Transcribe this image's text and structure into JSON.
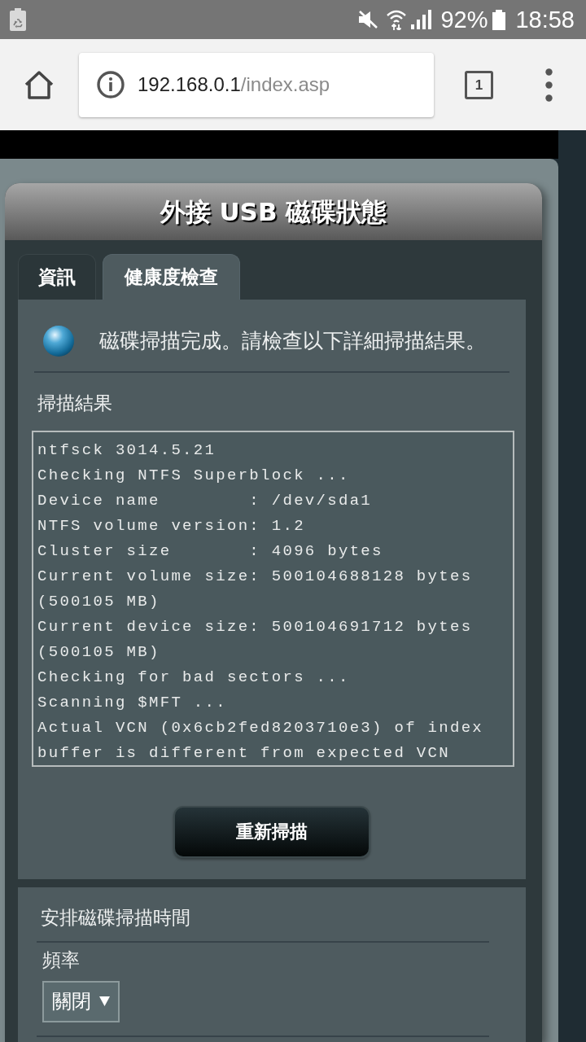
{
  "status_bar": {
    "battery_percent": "92%",
    "time": "18:58"
  },
  "browser": {
    "url_host": "192.168.0.1",
    "url_path": "/index.asp",
    "tab_count": "1"
  },
  "panel": {
    "title": "外接 USB 磁碟狀態",
    "tabs": [
      {
        "label": "資訊",
        "selected": false
      },
      {
        "label": "健康度檢查",
        "selected": true
      }
    ],
    "message": "磁碟掃描完成。請檢查以下詳細掃描結果。",
    "results_heading": "掃描結果",
    "scan_log": [
      "ntfsck 3014.5.21",
      "Checking NTFS Superblock ...",
      "Device name        : /dev/sda1",
      "NTFS volume version: 1.2",
      "Cluster size       : 4096 bytes",
      "Current volume size: 500104688128 bytes",
      "(500105 MB)",
      "Current device size: 500104691712 bytes",
      "(500105 MB)",
      "Checking for bad sectors ...",
      "Scanning $MFT ...",
      "Actual VCN (0x6cb2fed8203710e3) of index",
      "buffer is different from expected VCN"
    ],
    "rescan_button": "重新掃描"
  },
  "schedule": {
    "heading": "安排磁碟掃描時間",
    "frequency_label": "頻率",
    "frequency_value": "關閉"
  }
}
